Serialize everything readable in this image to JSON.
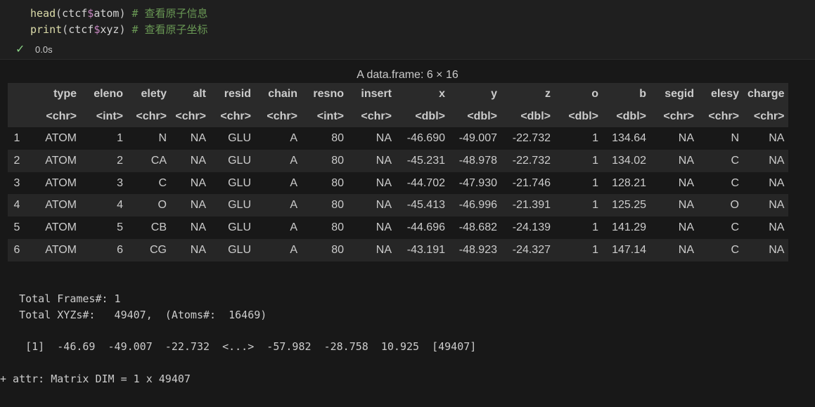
{
  "code": {
    "line1": {
      "fn": "head",
      "open": "(",
      "obj": "ctcf",
      "dollar": "$",
      "field": "atom",
      "close": ")",
      "comment": " # 查看原子信息"
    },
    "line2": {
      "fn": "print",
      "open": "(",
      "obj": "ctcf",
      "dollar": "$",
      "field": "xyz",
      "close": ")",
      "comment": " # 查看原子坐标"
    },
    "status_time": "0.0s",
    "status_icon": "check-icon"
  },
  "dataframe": {
    "caption": "A data.frame: 6 × 16",
    "columns": [
      "",
      "type",
      "eleno",
      "elety",
      "alt",
      "resid",
      "chain",
      "resno",
      "insert",
      "x",
      "y",
      "z",
      "o",
      "b",
      "segid",
      "elesy",
      "charge"
    ],
    "types": [
      "",
      "<chr>",
      "<int>",
      "<chr>",
      "<chr>",
      "<chr>",
      "<chr>",
      "<int>",
      "<chr>",
      "<dbl>",
      "<dbl>",
      "<dbl>",
      "<dbl>",
      "<dbl>",
      "<chr>",
      "<chr>",
      "<chr>"
    ],
    "rows": [
      [
        "1",
        "ATOM",
        "1",
        "N",
        "NA",
        "GLU",
        "A",
        "80",
        "NA",
        "-46.690",
        "-49.007",
        "-22.732",
        "1",
        "134.64",
        "NA",
        "N",
        "NA"
      ],
      [
        "2",
        "ATOM",
        "2",
        "CA",
        "NA",
        "GLU",
        "A",
        "80",
        "NA",
        "-45.231",
        "-48.978",
        "-22.732",
        "1",
        "134.02",
        "NA",
        "C",
        "NA"
      ],
      [
        "3",
        "ATOM",
        "3",
        "C",
        "NA",
        "GLU",
        "A",
        "80",
        "NA",
        "-44.702",
        "-47.930",
        "-21.746",
        "1",
        "128.21",
        "NA",
        "C",
        "NA"
      ],
      [
        "4",
        "ATOM",
        "4",
        "O",
        "NA",
        "GLU",
        "A",
        "80",
        "NA",
        "-45.413",
        "-46.996",
        "-21.391",
        "1",
        "125.25",
        "NA",
        "O",
        "NA"
      ],
      [
        "5",
        "ATOM",
        "5",
        "CB",
        "NA",
        "GLU",
        "A",
        "80",
        "NA",
        "-44.696",
        "-48.682",
        "-24.139",
        "1",
        "141.29",
        "NA",
        "C",
        "NA"
      ],
      [
        "6",
        "ATOM",
        "6",
        "CG",
        "NA",
        "GLU",
        "A",
        "80",
        "NA",
        "-43.191",
        "-48.923",
        "-24.327",
        "1",
        "147.14",
        "NA",
        "C",
        "NA"
      ]
    ]
  },
  "console": {
    "line1": "   Total Frames#: 1",
    "line2": "   Total XYZs#:   49407,  (Atoms#:  16469)",
    "line3": "    [1]  -46.69  -49.007  -22.732  <...>  -57.982  -28.758  10.925  [49407]",
    "line4": "+ attr: Matrix DIM = 1 x 49407"
  }
}
